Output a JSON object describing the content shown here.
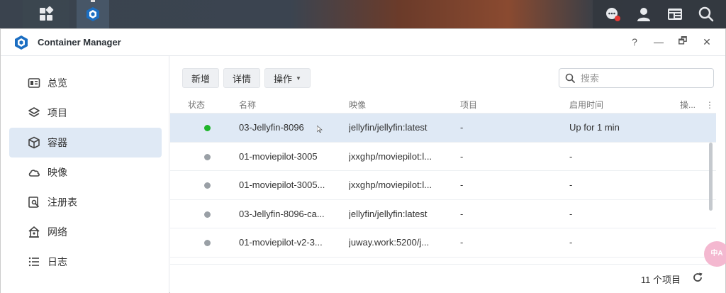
{
  "window": {
    "title": "Container Manager",
    "help_label": "?",
    "minimize_label": "—",
    "restore_label": "🗗",
    "close_label": "✕"
  },
  "sidebar": {
    "items": [
      {
        "label": "总览",
        "icon": "overview-icon"
      },
      {
        "label": "项目",
        "icon": "project-layers-icon"
      },
      {
        "label": "容器",
        "icon": "container-cube-icon",
        "active": true
      },
      {
        "label": "映像",
        "icon": "image-cloud-icon"
      },
      {
        "label": "注册表",
        "icon": "registry-search-icon"
      },
      {
        "label": "网络",
        "icon": "network-house-icon"
      },
      {
        "label": "日志",
        "icon": "log-list-icon"
      }
    ]
  },
  "toolbar": {
    "new_label": "新增",
    "details_label": "详情",
    "actions_label": "操作"
  },
  "search": {
    "placeholder": "搜索"
  },
  "table": {
    "columns": {
      "status": "状态",
      "name": "名称",
      "image": "映像",
      "project": "项目",
      "uptime": "启用时间",
      "ops": "操...",
      "more": "⋮"
    },
    "rows": [
      {
        "status": "running",
        "name": "03-Jellyfin-8096",
        "image": "jellyfin/jellyfin:latest",
        "project": "-",
        "uptime": "Up for 1 min",
        "selected": true
      },
      {
        "status": "stopped",
        "name": "01-moviepilot-3005",
        "image": "jxxghp/moviepilot:l...",
        "project": "-",
        "uptime": "-"
      },
      {
        "status": "stopped",
        "name": "01-moviepilot-3005...",
        "image": "jxxghp/moviepilot:l...",
        "project": "-",
        "uptime": "-"
      },
      {
        "status": "stopped",
        "name": "03-Jellyfin-8096-ca...",
        "image": "jellyfin/jellyfin:latest",
        "project": "-",
        "uptime": "-"
      },
      {
        "status": "stopped",
        "name": "01-moviepilot-v2-3...",
        "image": "juway.work:5200/j...",
        "project": "-",
        "uptime": "-"
      }
    ]
  },
  "footer": {
    "count_text": "11 个项目"
  },
  "translate_badge": {
    "label": "中A"
  },
  "colors": {
    "accent": "#dfe9f5",
    "running": "#1fb52a",
    "stopped": "#9aa0a6"
  }
}
